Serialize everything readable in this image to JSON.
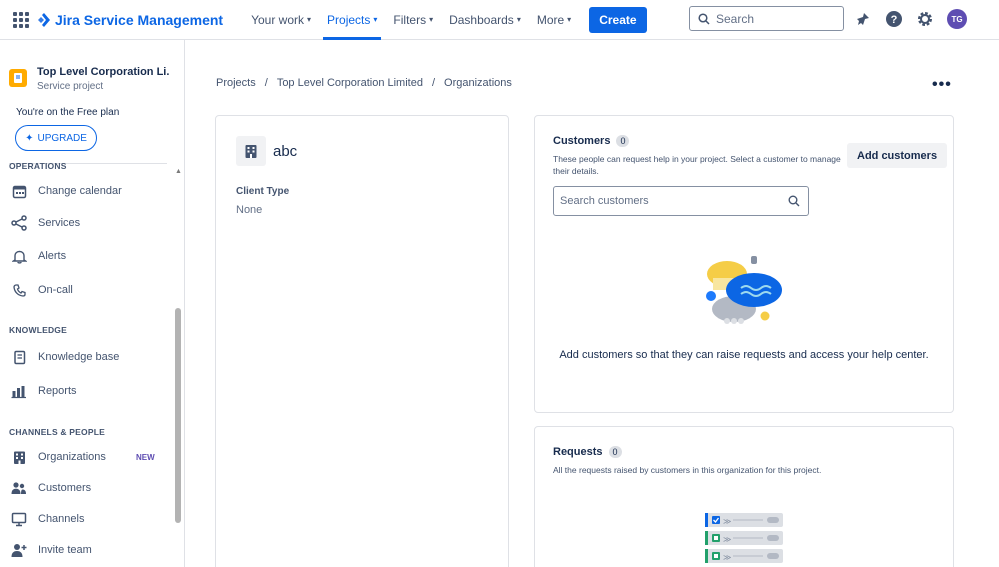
{
  "app": {
    "name": "Jira Service Management"
  },
  "nav": {
    "items": [
      {
        "label": "Your work",
        "dropdown": true,
        "active": false
      },
      {
        "label": "Projects",
        "dropdown": true,
        "active": true
      },
      {
        "label": "Filters",
        "dropdown": true,
        "active": false
      },
      {
        "label": "Dashboards",
        "dropdown": true,
        "active": false
      },
      {
        "label": "More",
        "dropdown": true,
        "active": false
      }
    ],
    "create_label": "Create",
    "search_placeholder": "Search",
    "avatar_initials": "TG"
  },
  "sidebar": {
    "project_name": "Top Level Corporation Li...",
    "project_type": "Service project",
    "plan_text": "You're on the Free plan",
    "upgrade_label": "UPGRADE",
    "section_operations": "OPERATIONS",
    "operations": [
      {
        "label": "Change calendar",
        "icon": "calendar-icon"
      },
      {
        "label": "Services",
        "icon": "services-icon"
      },
      {
        "label": "Alerts",
        "icon": "bell-icon"
      },
      {
        "label": "On-call",
        "icon": "phone-icon"
      }
    ],
    "section_knowledge": "KNOWLEDGE",
    "knowledge": [
      {
        "label": "Knowledge base",
        "icon": "book-icon"
      },
      {
        "label": "Reports",
        "icon": "chart-icon"
      }
    ],
    "section_channels": "CHANNELS & PEOPLE",
    "channels": [
      {
        "label": "Organizations",
        "icon": "building-icon",
        "badge": "NEW"
      },
      {
        "label": "Customers",
        "icon": "people-icon"
      },
      {
        "label": "Channels",
        "icon": "monitor-icon"
      },
      {
        "label": "Invite team",
        "icon": "person-add-icon"
      }
    ]
  },
  "breadcrumb": [
    "Projects",
    "Top Level Corporation Limited",
    "Organizations"
  ],
  "organization": {
    "name": "abc",
    "field_label": "Client Type",
    "field_value": "None"
  },
  "customers": {
    "title": "Customers",
    "count": "0",
    "description_line1": "These people can request help in your project. Select a customer to manage",
    "description_line2": "their details.",
    "add_label": "Add customers",
    "search_placeholder": "Search customers",
    "empty_message": "Add customers so that they can raise requests and access your help center."
  },
  "requests": {
    "title": "Requests",
    "count": "0",
    "description": "All the requests raised by customers in this organization for this project."
  },
  "colors": {
    "brand": "#0c66e4",
    "text": "#172b4d",
    "subtle": "#44546f",
    "border": "#dfe1e6",
    "new_badge": "#5e4db2"
  }
}
